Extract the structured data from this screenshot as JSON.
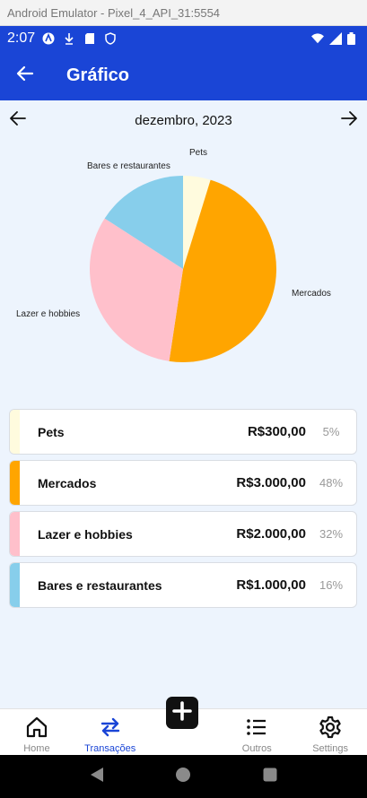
{
  "emulator": {
    "title": "Android Emulator - Pixel_4_API_31:5554"
  },
  "status_bar": {
    "time": "2:07",
    "icons_left": [
      "android-icon",
      "download-icon",
      "sd-card-icon",
      "shield-icon"
    ],
    "icons_right": [
      "wifi-icon",
      "signal-icon",
      "battery-icon"
    ]
  },
  "app_bar": {
    "title": "Gráfico",
    "back_icon": "arrow-left-icon",
    "background": "#1a45d6"
  },
  "month_nav": {
    "label": "dezembro, 2023",
    "prev_icon": "arrow-left-icon",
    "next_icon": "arrow-right-icon"
  },
  "chart_data": {
    "type": "pie",
    "title": "",
    "slices": [
      {
        "label": "Pets",
        "value": 300,
        "percent": 5,
        "color": "#fffbde"
      },
      {
        "label": "Mercados",
        "value": 3000,
        "percent": 48,
        "color": "#ffa500"
      },
      {
        "label": "Lazer e hobbies",
        "value": 2000,
        "percent": 32,
        "color": "#ffc0cb"
      },
      {
        "label": "Bares e restaurantes",
        "value": 1000,
        "percent": 16,
        "color": "#87ceeb"
      }
    ]
  },
  "categories": [
    {
      "name": "Pets",
      "amount": "R$300,00",
      "pct": "5%",
      "color": "#fffbde"
    },
    {
      "name": "Mercados",
      "amount": "R$3.000,00",
      "pct": "48%",
      "color": "#ffa500"
    },
    {
      "name": "Lazer e hobbies",
      "amount": "R$2.000,00",
      "pct": "32%",
      "color": "#ffc0cb"
    },
    {
      "name": "Bares e restaurantes",
      "amount": "R$1.000,00",
      "pct": "16%",
      "color": "#87ceeb"
    }
  ],
  "bottom_nav": {
    "items": [
      {
        "label": "Home",
        "icon": "home-icon",
        "active": false
      },
      {
        "label": "Transações",
        "icon": "transfer-icon",
        "active": true
      },
      {
        "label": "",
        "icon": "plus-icon",
        "active": false
      },
      {
        "label": "Outros",
        "icon": "list-icon",
        "active": false
      },
      {
        "label": "Settings",
        "icon": "gear-icon",
        "active": false
      }
    ]
  },
  "colors": {
    "accent": "#1a45d6",
    "background": "#edf4fd"
  }
}
